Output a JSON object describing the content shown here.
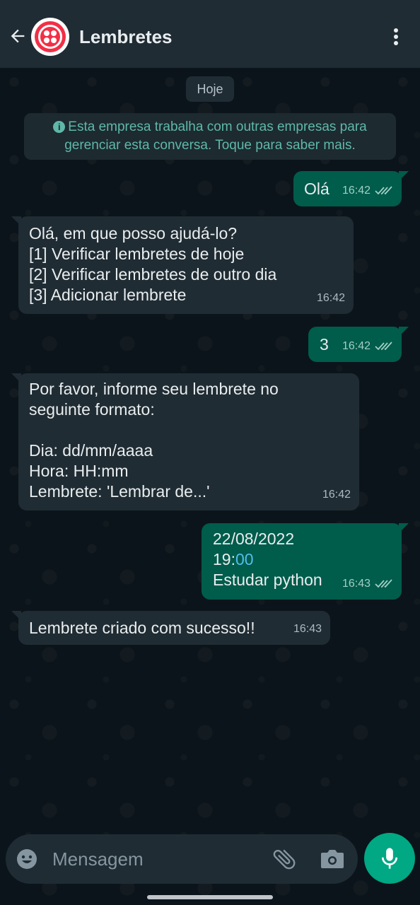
{
  "header": {
    "title": "Lembretes",
    "back_icon": "arrow-left-icon",
    "menu_icon": "more-vertical-icon"
  },
  "chat": {
    "date_label": "Hoje",
    "notice": "Esta empresa trabalha com outras empresas para gerenciar esta conversa. Toque para saber mais.",
    "messages": [
      {
        "direction": "out",
        "text": "Olá",
        "time": "16:42",
        "status": "read"
      },
      {
        "direction": "in",
        "text": "Olá, em que posso ajudá-lo?\n[1] Verificar lembretes de hoje\n[2] Verificar lembretes de outro dia\n[3] Adicionar lembrete",
        "time": "16:42"
      },
      {
        "direction": "out",
        "text": "3",
        "time": "16:42",
        "status": "read"
      },
      {
        "direction": "in",
        "text": "Por favor, informe seu lembrete no\nseguinte formato:\n\nDia: dd/mm/aaaa\nHora: HH:mm\nLembrete: 'Lembrar de...'",
        "time": "16:42"
      },
      {
        "direction": "out",
        "line1": "22/08/2022",
        "line2_a": "19:",
        "line2_b": "00",
        "line3": "Estudar python",
        "time": "16:43",
        "status": "read"
      },
      {
        "direction": "in",
        "text": "Lembrete criado com sucesso!!",
        "time": "16:43"
      }
    ]
  },
  "composer": {
    "placeholder": "Mensagem"
  },
  "colors": {
    "header_bg": "#1f2c34",
    "chat_bg": "#0b141a",
    "incoming_bubble": "#202c33",
    "outgoing_bubble": "#005c4b",
    "accent": "#00a884",
    "notice_text": "#5fb8a8"
  }
}
